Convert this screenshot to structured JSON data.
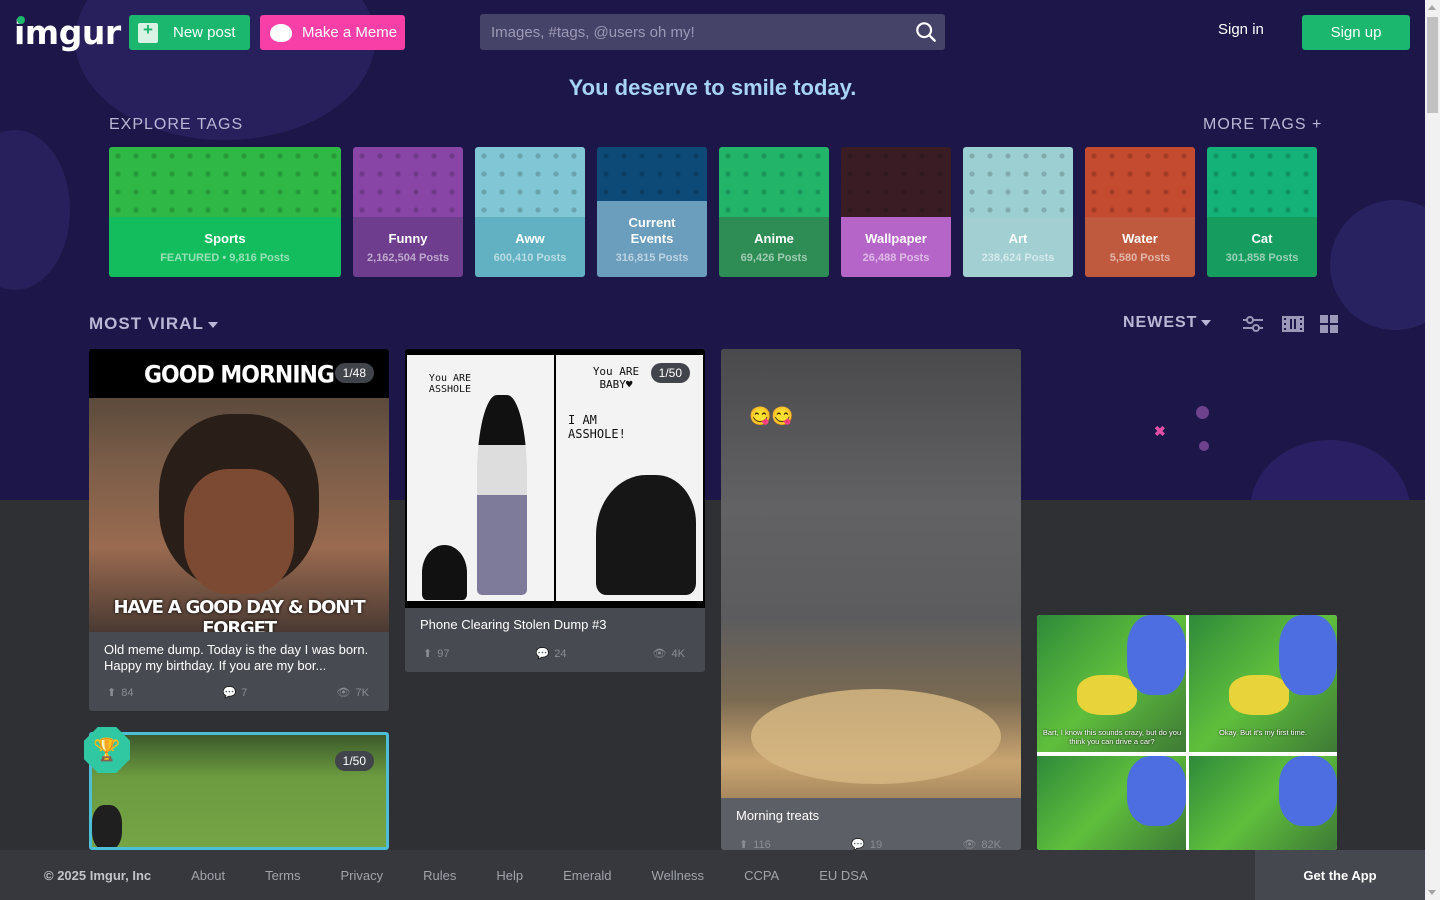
{
  "header": {
    "logo": "imgur",
    "new_post_label": "New post",
    "make_meme_label": "Make a Meme",
    "search_placeholder": "Images, #tags, @users oh my!",
    "signin_label": "Sign in",
    "signup_label": "Sign up"
  },
  "tagline": "You deserve to smile today.",
  "explore": {
    "title": "EXPLORE TAGS",
    "more_tags": "MORE TAGS +",
    "tags": [
      {
        "name": "Sports",
        "count": "FEATURED • 9,816 Posts",
        "pattern_color": "#2fb845",
        "info_color": "#13bd5e",
        "featured": true
      },
      {
        "name": "Funny",
        "count": "2,162,504 Posts",
        "pattern_color": "#8845a6",
        "info_color": "#6e3d8e"
      },
      {
        "name": "Aww",
        "count": "600,410 Posts",
        "pattern_color": "#81c6d4",
        "info_color": "#61b1c2"
      },
      {
        "name": "Current Events",
        "count": "316,815 Posts",
        "pattern_color": "#0e4a78",
        "info_color": "#6b9dbd"
      },
      {
        "name": "Anime",
        "count": "69,426 Posts",
        "pattern_color": "#22b56a",
        "info_color": "#2d8d54"
      },
      {
        "name": "Wallpaper",
        "count": "26,488 Posts",
        "pattern_color": "#3a1d24",
        "info_color": "#b565c8"
      },
      {
        "name": "Art",
        "count": "238,624 Posts",
        "pattern_color": "#9ccfd2",
        "info_color": "#a1cfd2"
      },
      {
        "name": "Water",
        "count": "5,580 Posts",
        "pattern_color": "#c44a30",
        "info_color": "#c05a3f"
      },
      {
        "name": "Cat",
        "count": "301,858 Posts",
        "pattern_color": "#14b278",
        "info_color": "#179c5f"
      }
    ]
  },
  "sort": {
    "section": "MOST VIRAL",
    "order": "NEWEST",
    "view_icons": [
      "settings-sliders-icon",
      "list-view-icon",
      "grid-view-icon"
    ]
  },
  "posts": [
    {
      "title": "Old meme dump. Today is the day I was born. Happy my birthday. If you are my bor...",
      "image_badge": "1/48",
      "image_top_text": "GOOD MORNING",
      "image_bottom_text": "HAVE A GOOD DAY & DON'T FORGET",
      "upvotes": "84",
      "comments": "7",
      "views": "7K"
    },
    {
      "title": "Phone Clearing Stolen Dump #3",
      "image_badge": "1/50",
      "image_caption_left": "You ARE ASSHOLE",
      "image_caption_right": "You ARE BABY♥",
      "image_caption_mid": "I AM ASSHOLE!",
      "upvotes": "97",
      "comments": "24",
      "views": "4K"
    },
    {
      "title": "Morning treats",
      "image_emoji": "😋😋",
      "upvotes": "116",
      "comments": "19",
      "views": "82K"
    },
    {
      "image_badge": "1/50"
    },
    {
      "image_caption_left": "Bart, I know this sounds crazy, but do you think you can drive a car?",
      "image_caption_right": "Okay. But it's my first time."
    }
  ],
  "footer": {
    "copyright": "© 2025 Imgur, Inc",
    "links": [
      "About",
      "Terms",
      "Privacy",
      "Rules",
      "Help",
      "Emerald",
      "Wellness",
      "CCPA",
      "EU DSA"
    ],
    "get_app": "Get the App"
  }
}
